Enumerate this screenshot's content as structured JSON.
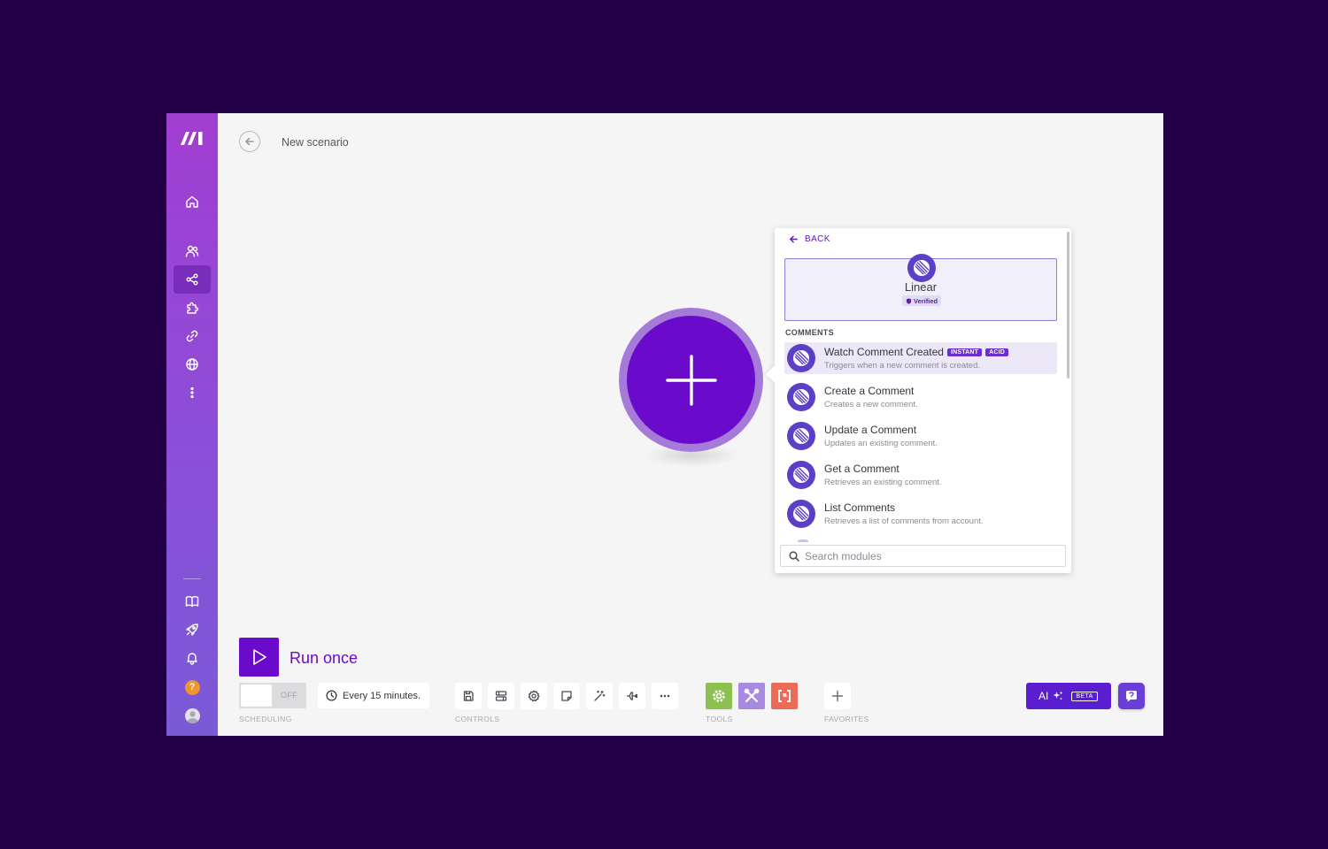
{
  "header": {
    "title": "New scenario"
  },
  "sidebar": {
    "items": [
      {
        "name": "home-icon"
      },
      {
        "name": "team-icon"
      },
      {
        "name": "scenarios-icon"
      },
      {
        "name": "apps-icon"
      },
      {
        "name": "connections-icon"
      },
      {
        "name": "webhooks-icon"
      },
      {
        "name": "more-icon"
      }
    ],
    "bottom_items": [
      {
        "name": "docs-icon"
      },
      {
        "name": "rocket-icon"
      },
      {
        "name": "bell-icon"
      },
      {
        "name": "help-icon",
        "text": "?"
      },
      {
        "name": "avatar"
      }
    ]
  },
  "popover": {
    "back_label": "BACK",
    "app": {
      "name": "Linear",
      "badge": "Verified"
    },
    "section_label": "COMMENTS",
    "modules": [
      {
        "name": "Watch Comment Created",
        "desc": "Triggers when a new comment is created.",
        "tags": [
          "INSTANT",
          "ACID"
        ],
        "highlighted": true
      },
      {
        "name": "Create a Comment",
        "desc": "Creates a new comment."
      },
      {
        "name": "Update a Comment",
        "desc": "Updates an existing comment."
      },
      {
        "name": "Get a Comment",
        "desc": "Retrieves an existing comment."
      },
      {
        "name": "List Comments",
        "desc": "Retrieves a list of comments from account."
      }
    ],
    "search": {
      "placeholder": "Search modules",
      "value": ""
    }
  },
  "run": {
    "label": "Run once"
  },
  "toolbar": {
    "toggle_label": "OFF",
    "schedule_label": "Every 15 minutes.",
    "groups": {
      "scheduling": "SCHEDULING",
      "controls": "CONTROLS",
      "tools": "TOOLS",
      "favorites": "FAVORITES"
    },
    "controls": [
      "save-icon",
      "auto-align-icon",
      "settings-icon",
      "notes-icon",
      "magic-wand-icon",
      "airplane-icon",
      "more-icon"
    ],
    "tools": [
      {
        "name": "flow-control-gear-icon",
        "color": "#8cc152"
      },
      {
        "name": "tools-icon",
        "color": "#a88be0"
      },
      {
        "name": "text-parser-icon",
        "color": "#ec6b56"
      }
    ]
  },
  "ai": {
    "label": "AI",
    "badge": "BETA"
  },
  "colors": {
    "accent": "#6a0bcb",
    "app_icon": "#5c3fc8",
    "background": "#230046"
  }
}
